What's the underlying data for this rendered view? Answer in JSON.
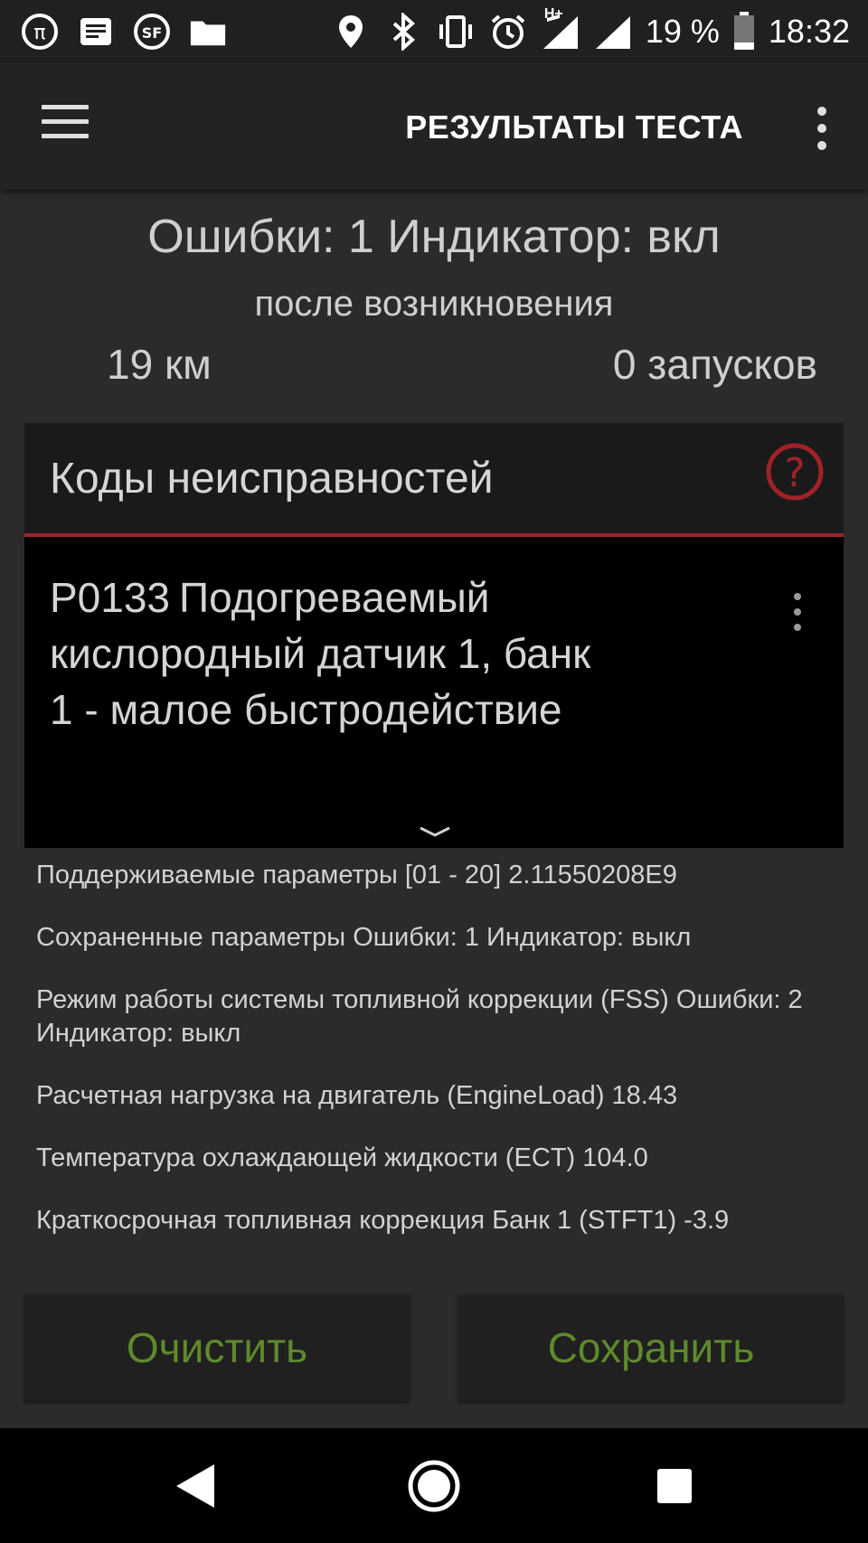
{
  "status_bar": {
    "left_icons": [
      "pi-icon",
      "notes-icon",
      "sf-icon",
      "folder-icon"
    ],
    "right_icons": [
      "location-icon",
      "bluetooth-icon",
      "vibrate-icon",
      "alarm-icon",
      "signal-icon",
      "signal-icon-2"
    ],
    "network_type": "H+",
    "battery": "19 %",
    "time": "18:32"
  },
  "app_bar": {
    "title": "РЕЗУЛЬТАТЫ ТЕСТА"
  },
  "summary": {
    "main": "Ошибки: 1 Индикатор: вкл",
    "since": "после возникновения",
    "distance": "19 км",
    "starts": "0 запусков"
  },
  "dtc_card": {
    "title": "Коды неисправностей",
    "code": "P0133",
    "description": "Подогреваемый кислородный датчик 1, банк 1 - малое быстродействие"
  },
  "params": [
    "Поддерживаемые параметры [01 - 20] 2.11550208E9",
    "Сохраненные параметры Ошибки: 1 Индикатор: выкл",
    "Режим работы системы топливной коррекции (FSS) Ошибки: 2 Индикатор: выкл",
    "Расчетная нагрузка на двигатель (EngineLoad) 18.43",
    "Температура охлаждающей жидкости (ECT) 104.0",
    "Краткосрочная топливная коррекция Банк 1 (STFT1) -3.9"
  ],
  "buttons": {
    "clear": "Очистить",
    "save": "Сохранить"
  },
  "colors": {
    "accent_green": "#5f8a2c",
    "accent_red": "#a02228",
    "background": "#2b2b2b"
  }
}
